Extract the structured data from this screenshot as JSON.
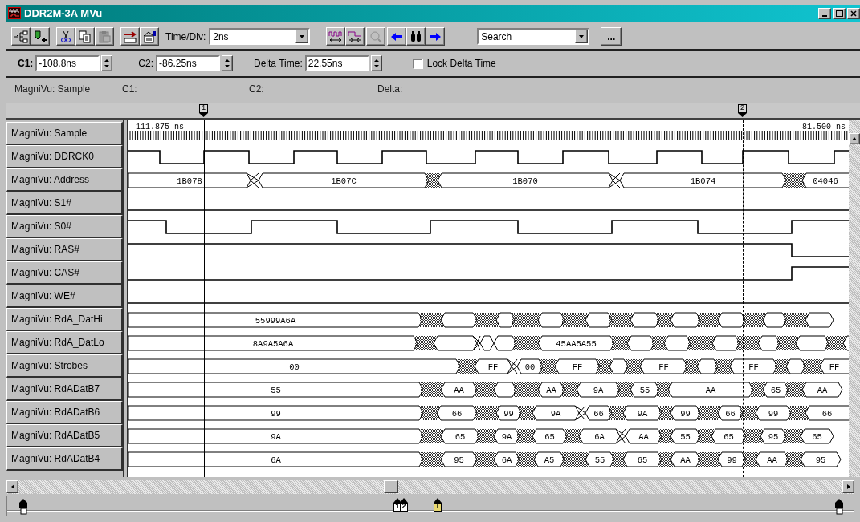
{
  "window": {
    "title": "DDR2M-3A MVu"
  },
  "toolbar": {
    "time_div": {
      "label": "Time/Div:",
      "value": "2ns"
    },
    "search": {
      "value": "Search"
    },
    "more_button": "..."
  },
  "cursor_bar": {
    "c1": {
      "label": "C1:",
      "value": "-108.8ns"
    },
    "c2": {
      "label": "C2:",
      "value": "-86.25ns"
    },
    "delta": {
      "label": "Delta Time:",
      "value": "22.55ns"
    },
    "lock": {
      "label": "Lock Delta Time",
      "checked": false
    }
  },
  "info_bar": [
    "MagniVu: Sample",
    "C1:",
    "C2:",
    "Delta:"
  ],
  "ruler_markers": [
    "1",
    "2"
  ],
  "waveform": {
    "start_time": "-111.875 ns",
    "end_time": "-81.500 ns",
    "signals": [
      {
        "name": "MagniVu: Sample",
        "kind": "sample"
      },
      {
        "name": "MagniVu: DDRCK0",
        "kind": "clock"
      },
      {
        "name": "MagniVu: Address",
        "kind": "bus",
        "values": [
          "1B078",
          "1B07C",
          "1B070",
          "1B074",
          "04046"
        ]
      },
      {
        "name": "MagniVu: S1#",
        "kind": "line"
      },
      {
        "name": "MagniVu: S0#",
        "kind": "line"
      },
      {
        "name": "MagniVu: RAS#",
        "kind": "line"
      },
      {
        "name": "MagniVu: CAS#",
        "kind": "line"
      },
      {
        "name": "MagniVu: WE#",
        "kind": "line"
      },
      {
        "name": "MagniVu: RdA_DatHi",
        "kind": "bus",
        "values": [
          "55999A6A"
        ]
      },
      {
        "name": "MagniVu: RdA_DatLo",
        "kind": "bus",
        "values": [
          "8A9A5A6A",
          "45AA5A55"
        ]
      },
      {
        "name": "MagniVu: Strobes",
        "kind": "bus",
        "values": [
          "00",
          "FF",
          "00",
          "FF",
          "FF",
          "FF",
          "FF"
        ]
      },
      {
        "name": "MagniVu: RdADatB7",
        "kind": "bus",
        "values": [
          "55",
          "AA",
          "AA",
          "9A",
          "55",
          "AA",
          "65",
          "AA"
        ]
      },
      {
        "name": "MagniVu: RdADatB6",
        "kind": "bus",
        "values": [
          "99",
          "66",
          "99",
          "9A",
          "66",
          "9A",
          "99",
          "66",
          "99",
          "66"
        ]
      },
      {
        "name": "MagniVu: RdADatB5",
        "kind": "bus",
        "values": [
          "9A",
          "65",
          "9A",
          "65",
          "6A",
          "AA",
          "55",
          "65",
          "95",
          "65"
        ]
      },
      {
        "name": "MagniVu: RdADatB4",
        "kind": "bus",
        "values": [
          "6A",
          "95",
          "6A",
          "A5",
          "55",
          "65",
          "AA",
          "99",
          "AA",
          "95"
        ]
      }
    ]
  },
  "bottom_markers": [
    "1",
    "2",
    "T"
  ]
}
